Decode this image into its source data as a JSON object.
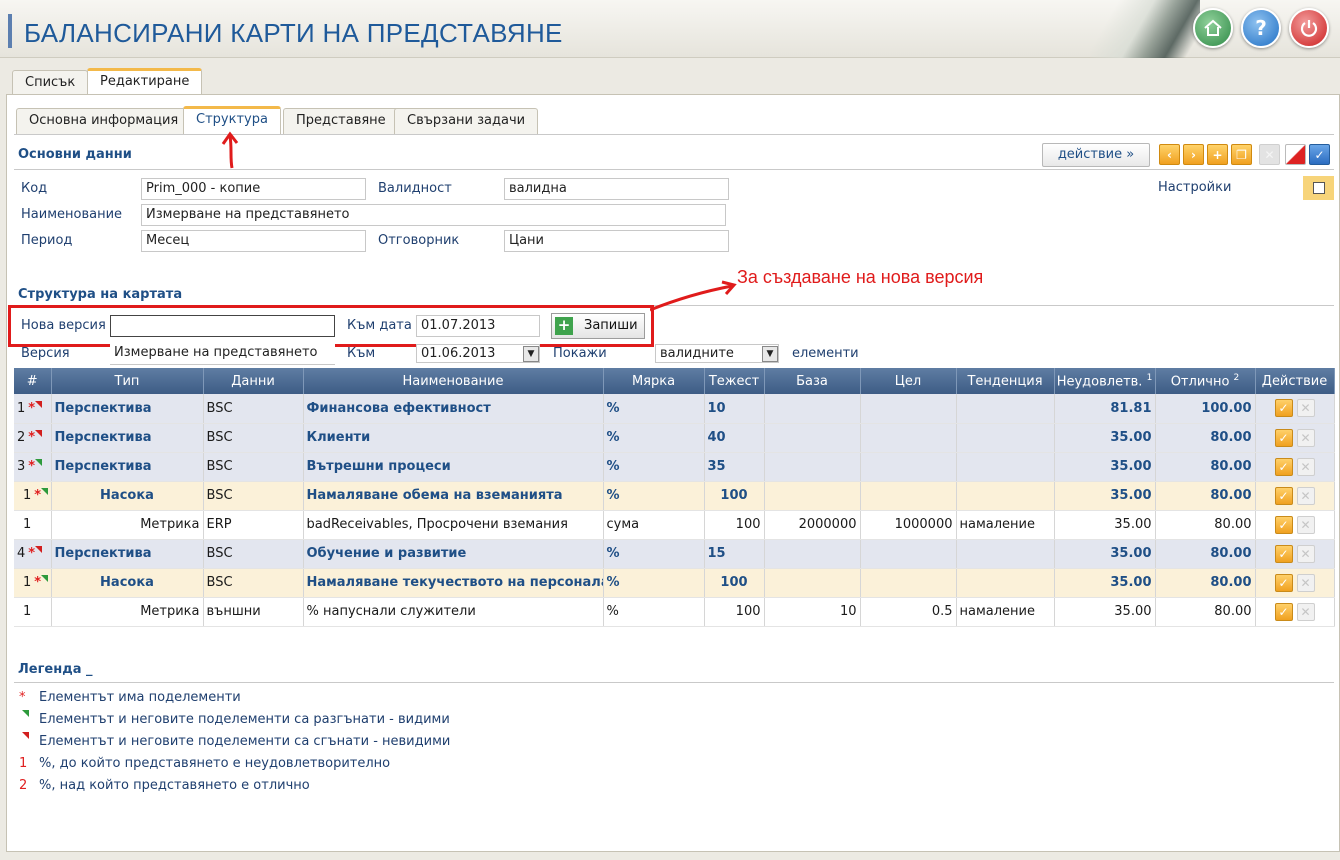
{
  "app": {
    "title": "БАЛАНСИРАНИ КАРТИ НА ПРЕДСТАВЯНЕ",
    "header_buttons": [
      {
        "name": "home-icon",
        "color": "#2f8a46"
      },
      {
        "name": "help-icon",
        "label": "?",
        "color": "#1f6fc4"
      },
      {
        "name": "power-icon",
        "color": "#cc1f1f"
      }
    ]
  },
  "tabs": [
    "Списък",
    "Редактиране"
  ],
  "subtabs": [
    "Основна информация",
    "Структура",
    "Представяне",
    "Свързани задачи"
  ],
  "basic": {
    "title": "Основни данни",
    "action_button": "действие »",
    "settings_label": "Настройки",
    "fields": {
      "code_label": "Код",
      "code_value": "Prim_000 - копие",
      "validity_label": "Валидност",
      "validity_value": "валидна",
      "name_label": "Наименование",
      "name_value": "Измерване на представянето",
      "period_label": "Период",
      "period_value": "Месец",
      "owner_label": "Отговорник",
      "owner_value": "Цани"
    }
  },
  "structure": {
    "title": "Структура на картата",
    "annotation": "За създаване на нова версия",
    "new_version_label": "Нова версия",
    "new_version_value": "",
    "to_date_label": "Към дата",
    "to_date_value": "01.07.2013",
    "save_button": "Запиши",
    "version_label": "Версия",
    "version_value": "Измерване на представянето",
    "to_label": "Към",
    "to_value": "01.06.2013",
    "show_label": "Покажи",
    "show_value": "валидните",
    "elements_label": "елементи"
  },
  "table": {
    "columns": [
      "#",
      "Тип",
      "Данни",
      "Наименование",
      "Мярка",
      "Тежест",
      "База",
      "Цел",
      "Тенденция",
      "Неудовлетв.",
      "Отлично",
      "Действие"
    ],
    "unsat_sup": "1",
    "excellent_sup": "2",
    "rows": [
      {
        "kind": "persp",
        "num": "1",
        "flag": "red",
        "type": "Перспектива",
        "data": "BSC",
        "name": "Финансова ефективност",
        "unit": "%",
        "weight": "10",
        "base": "",
        "target": "",
        "trend": "",
        "unsat": "81.81",
        "exc": "100.00"
      },
      {
        "kind": "persp",
        "num": "2",
        "flag": "red",
        "type": "Перспектива",
        "data": "BSC",
        "name": "Клиенти",
        "unit": "%",
        "weight": "40",
        "base": "",
        "target": "",
        "trend": "",
        "unsat": "35.00",
        "exc": "80.00"
      },
      {
        "kind": "persp",
        "num": "3",
        "flag": "green",
        "type": "Перспектива",
        "data": "BSC",
        "name": "Вътрешни процеси",
        "unit": "%",
        "weight": "35",
        "base": "",
        "target": "",
        "trend": "",
        "unsat": "35.00",
        "exc": "80.00"
      },
      {
        "kind": "nasoka",
        "num": "1",
        "flag": "green",
        "type": "Насока",
        "data": "BSC",
        "name": "Намаляване обема на вземанията",
        "unit": "%",
        "weight": "100",
        "base": "",
        "target": "",
        "trend": "",
        "unsat": "35.00",
        "exc": "80.00"
      },
      {
        "kind": "metric",
        "num": "1",
        "flag": "",
        "type": "Метрика",
        "data": "ERP",
        "name": "badReceivables, Просрочени вземания",
        "unit": "сума",
        "weight": "100",
        "base": "2000000",
        "target": "1000000",
        "trend": "намаление",
        "unsat": "35.00",
        "exc": "80.00"
      },
      {
        "kind": "persp",
        "num": "4",
        "flag": "red",
        "type": "Перспектива",
        "data": "BSC",
        "name": "Обучение и развитие",
        "unit": "%",
        "weight": "15",
        "base": "",
        "target": "",
        "trend": "",
        "unsat": "35.00",
        "exc": "80.00"
      },
      {
        "kind": "nasoka",
        "num": "1",
        "flag": "green",
        "type": "Насока",
        "data": "BSC",
        "name": "Намаляване текучеството на персонала",
        "unit": "%",
        "weight": "100",
        "base": "",
        "target": "",
        "trend": "",
        "unsat": "35.00",
        "exc": "80.00"
      },
      {
        "kind": "metric",
        "num": "1",
        "flag": "",
        "type": "Метрика",
        "data": "външни",
        "name": "% напуснали служители",
        "unit": "%",
        "weight": "100",
        "base": "10",
        "target": "0.5",
        "trend": "намаление",
        "unsat": "35.00",
        "exc": "80.00"
      }
    ]
  },
  "legend": {
    "title": "Легенда _",
    "items": [
      {
        "key": "*",
        "text": "Елементът има поделементи"
      },
      {
        "key": "",
        "text": "Елементът и неговите поделементи са разгънати - видими"
      },
      {
        "key": "",
        "text": "Елементът и неговите поделементи са сгънати - невидими"
      },
      {
        "key": "1",
        "text": "%, до който представянето е неудовлетворително"
      },
      {
        "key": "2",
        "text": "%, над който представянето е отлично"
      }
    ]
  }
}
